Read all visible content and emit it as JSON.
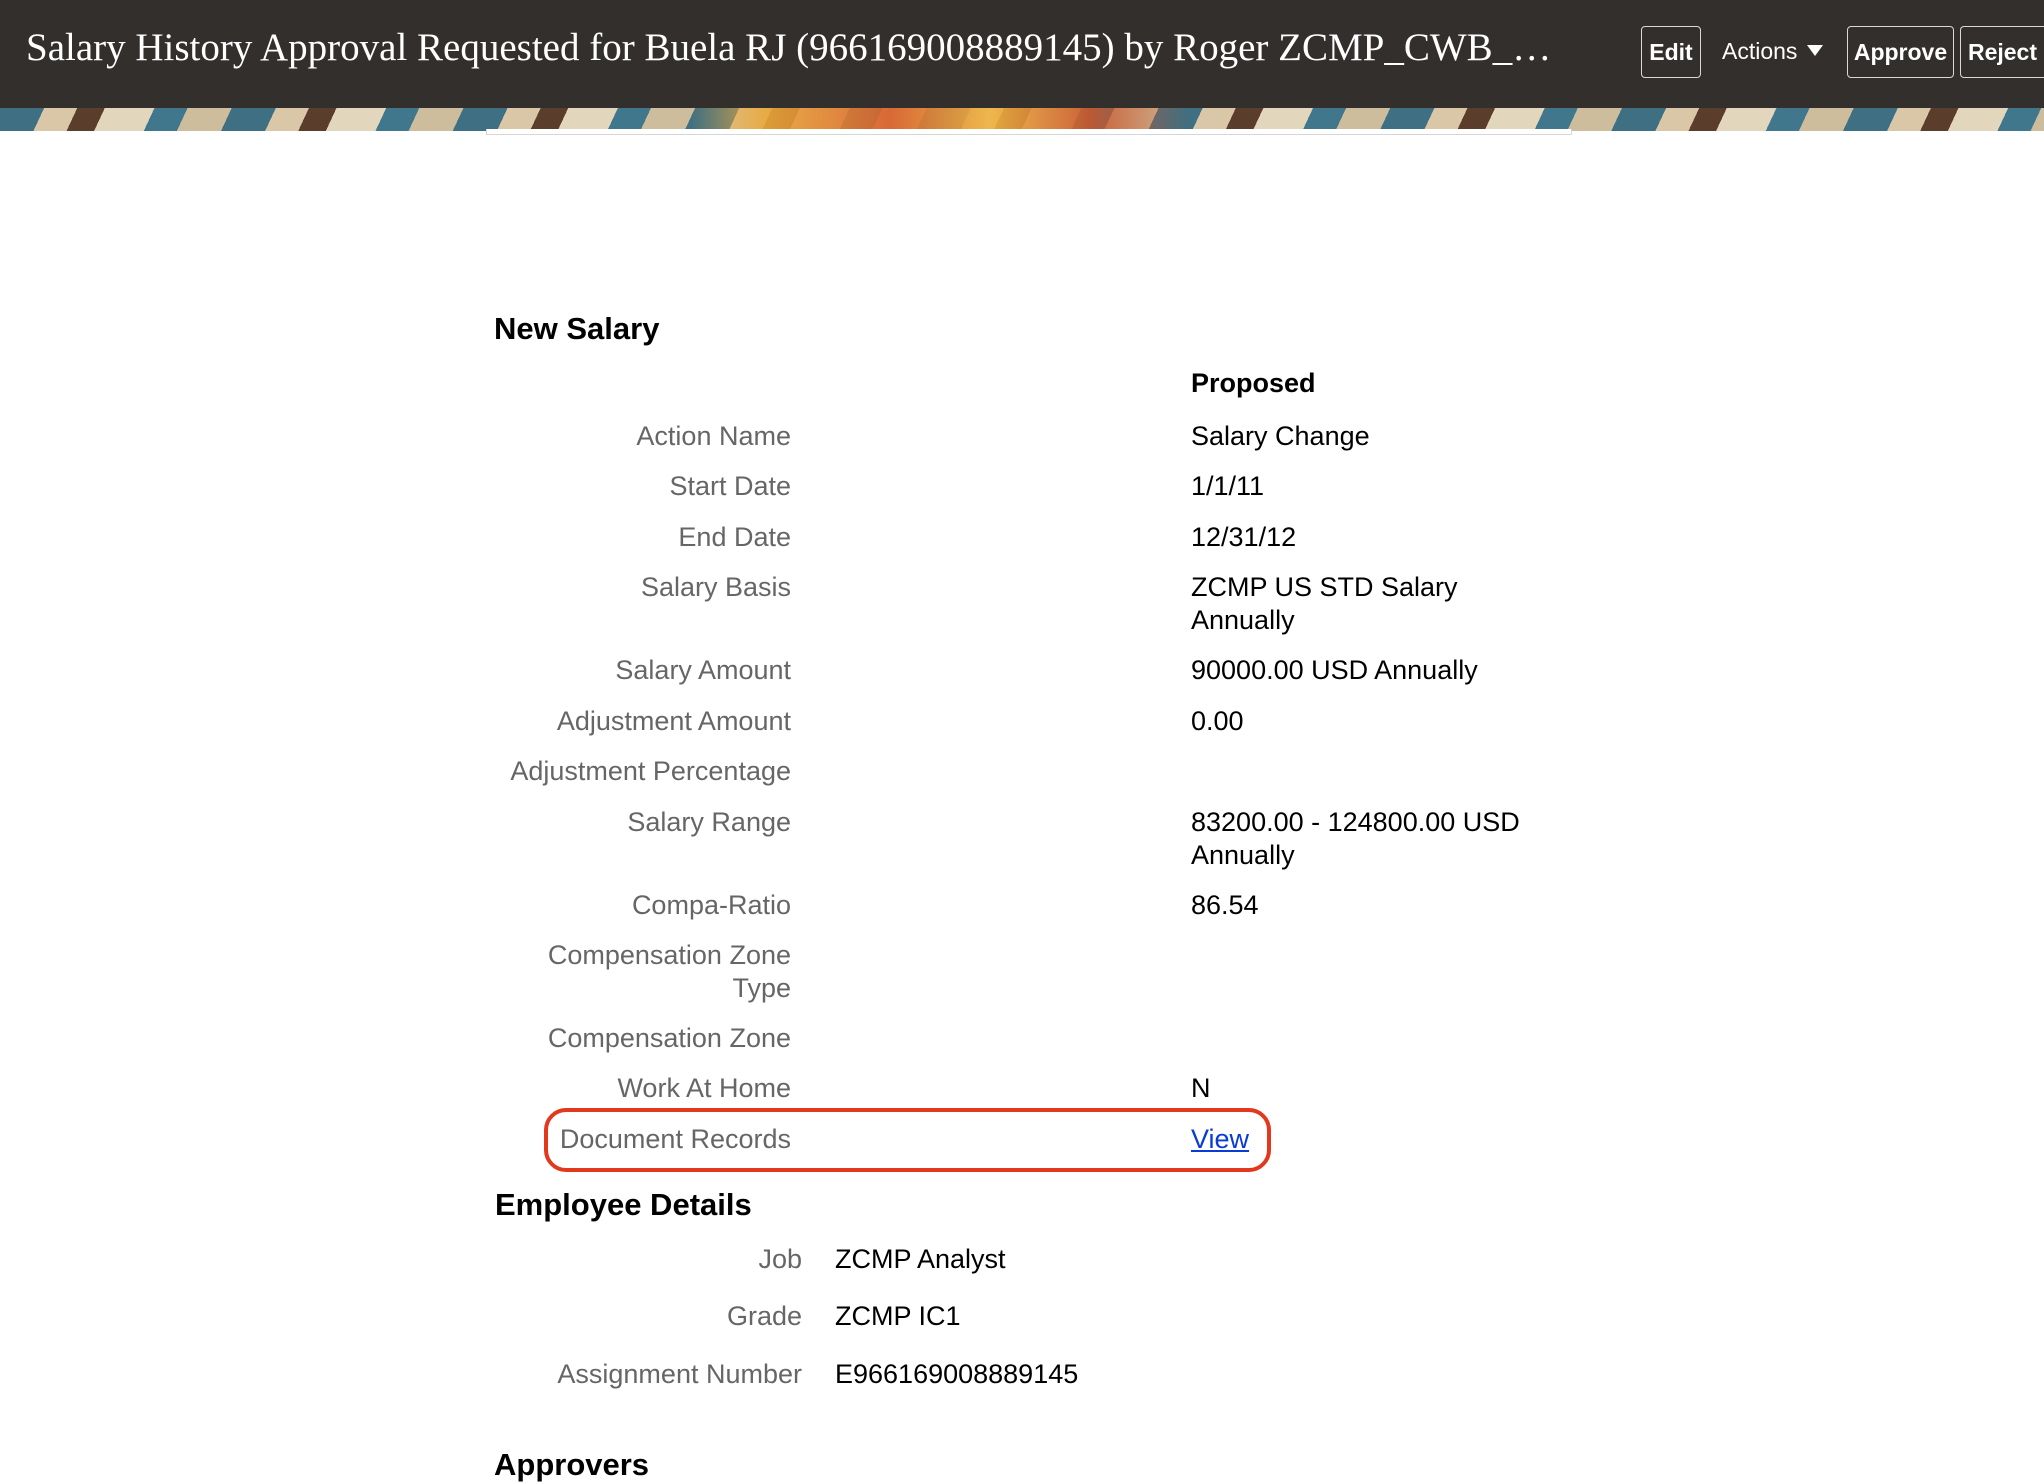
{
  "header": {
    "title": "Salary History Approval Requested for Buela RJ (966169008889145) by Roger ZCMP_CWB_…",
    "edit_label": "Edit",
    "actions_label": "Actions",
    "approve_label": "Approve",
    "reject_label": "Reject"
  },
  "new_salary": {
    "title": "New Salary",
    "column_header": "Proposed",
    "rows": [
      {
        "label": "Action Name",
        "value": "Salary Change"
      },
      {
        "label": "Start Date",
        "value": "1/1/11"
      },
      {
        "label": "End Date",
        "value": "12/31/12"
      },
      {
        "label": "Salary Basis",
        "value": "ZCMP US STD Salary Annually"
      },
      {
        "label": "Salary Amount",
        "value": "90000.00 USD Annually"
      },
      {
        "label": "Adjustment Amount",
        "value": "0.00"
      },
      {
        "label": "Adjustment Percentage",
        "value": ""
      },
      {
        "label": "Salary Range",
        "value": "83200.00 - 124800.00 USD Annually"
      },
      {
        "label": "Compa-Ratio",
        "value": "86.54"
      },
      {
        "label": "Compensation Zone Type",
        "value": ""
      },
      {
        "label": "Compensation Zone",
        "value": ""
      },
      {
        "label": "Work At Home",
        "value": "N"
      },
      {
        "label": "Document Records",
        "value": "View"
      }
    ]
  },
  "employee_details": {
    "title": "Employee Details",
    "rows": [
      {
        "label": "Job",
        "value": "ZCMP Analyst"
      },
      {
        "label": "Grade",
        "value": "ZCMP IC1"
      },
      {
        "label": "Assignment Number",
        "value": "E966169008889145"
      }
    ]
  },
  "approvers": {
    "title": "Approvers"
  },
  "colors": {
    "header_bg": "#332f2c",
    "highlight_border": "#e3371e",
    "link": "#0a3bd6",
    "label_text": "#666666"
  },
  "icons": {
    "actions_dropdown": "caret-down-icon"
  }
}
